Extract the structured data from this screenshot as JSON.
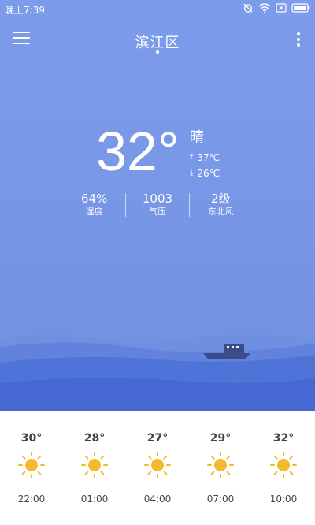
{
  "status_bar": {
    "time": "晚上7:39",
    "icons": [
      "alarm-off-icon",
      "wifi-icon",
      "sim-icon",
      "battery-icon"
    ]
  },
  "header": {
    "city": "滨江区",
    "menu_icon": "hamburger-menu-icon",
    "more_icon": "more-vert-icon"
  },
  "current": {
    "temperature": "32°",
    "condition": "晴",
    "high": "37℃",
    "low": "26℃"
  },
  "stats": [
    {
      "value": "64%",
      "label": "湿度"
    },
    {
      "value": "1003",
      "label": "气压"
    },
    {
      "value": "2级",
      "label": "东北风"
    }
  ],
  "forecast": [
    {
      "temp": "30°",
      "time": "22:00",
      "icon": "sun-icon"
    },
    {
      "temp": "28°",
      "time": "01:00",
      "icon": "sun-icon"
    },
    {
      "temp": "27°",
      "time": "04:00",
      "icon": "sun-icon"
    },
    {
      "temp": "29°",
      "time": "07:00",
      "icon": "sun-icon"
    },
    {
      "temp": "32°",
      "time": "10:00",
      "icon": "sun-icon"
    }
  ],
  "colors": {
    "sky": "#7896e6",
    "wave_dark": "#4b6fd6",
    "sun": "#f5b92e"
  }
}
